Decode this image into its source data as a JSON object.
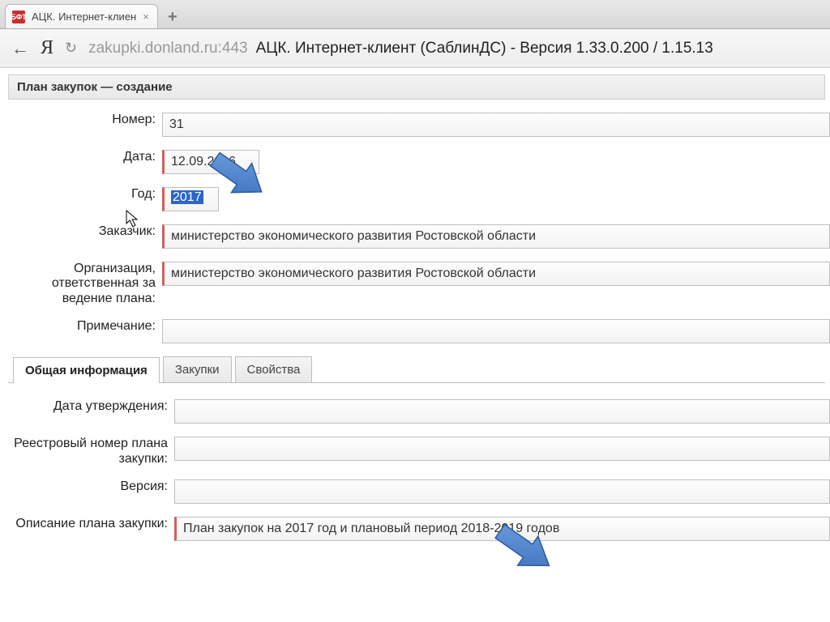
{
  "browser": {
    "tab_title": "АЦК. Интернет-клиен",
    "favicon_text": "БФТ",
    "url_host": "zakupki.donland.ru:443",
    "url_title": "АЦК. Интернет-клиент (СаблинДС) - Версия 1.33.0.200 / 1.15.13"
  },
  "page": {
    "title": "План закупок — создание"
  },
  "form": {
    "number_label": "Номер:",
    "number_value": "31",
    "date_label": "Дата:",
    "date_value": "12.09.2016",
    "year_label": "Год:",
    "year_value": "2017",
    "customer_label": "Заказчик:",
    "customer_value": "министерство экономического развития Ростовской области",
    "org_label": "Организация, ответственная за ведение плана:",
    "org_value": "министерство экономического развития Ростовской области",
    "note_label": "Примечание:",
    "note_value": ""
  },
  "tabs": {
    "general": "Общая информация",
    "purchases": "Закупки",
    "properties": "Свойства"
  },
  "subform": {
    "approval_date_label": "Дата утверждения:",
    "approval_date_value": "",
    "registry_label": "Реестровый номер плана закупки:",
    "registry_value": "",
    "version_label": "Версия:",
    "version_value": "",
    "description_label": "Описание плана закупки:",
    "description_value": "План закупок на 2017 год и плановый период 2018-2019 годов"
  }
}
